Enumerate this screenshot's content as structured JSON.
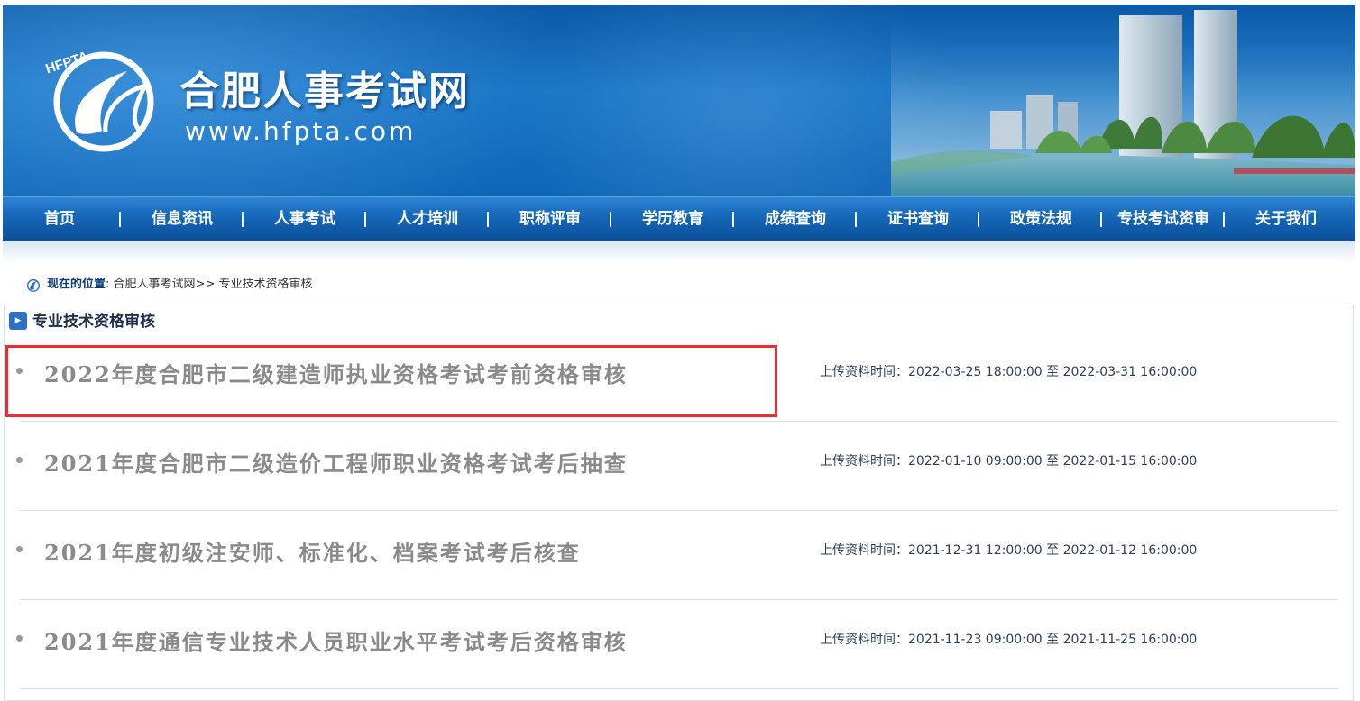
{
  "header": {
    "site_title": "合肥人事考试网",
    "site_url": "www.hfpta.com",
    "logo_text": "HFPTA"
  },
  "nav": {
    "items": [
      "首页",
      "信息资讯",
      "人事考试",
      "人才培训",
      "职称评审",
      "学历教育",
      "成绩查询",
      "证书查询",
      "政策法规",
      "专技考试资审",
      "关于我们"
    ],
    "separator": "|"
  },
  "breadcrumb": {
    "label": "现在的位置",
    "colon": ":",
    "home": "合肥人事考试网",
    "arrow": ">>",
    "current": "专业技术资格审核"
  },
  "section": {
    "title": "专业技术资格审核",
    "items": [
      {
        "title": "2022年度合肥市二级建造师执业资格考试考前资格审核",
        "time_label": "上传资料时间：",
        "start": "2022-03-25 18:00:00",
        "to": "至",
        "end": "2022-03-31 16:00:00"
      },
      {
        "title": "2021年度合肥市二级造价工程师职业资格考试考后抽查",
        "time_label": "上传资料时间：",
        "start": "2022-01-10 09:00:00",
        "to": "至",
        "end": "2022-01-15 16:00:00"
      },
      {
        "title": "2021年度初级注安师、标准化、档案考试考后核查",
        "time_label": "上传资料时间：",
        "start": "2021-12-31 12:00:00",
        "to": "至",
        "end": "2022-01-12 16:00:00"
      },
      {
        "title": "2021年度通信专业技术人员职业水平考试考后资格审核",
        "time_label": "上传资料时间：",
        "start": "2021-11-23 09:00:00",
        "to": "至",
        "end": "2021-11-25 16:00:00"
      }
    ]
  },
  "colors": {
    "banner_blue": "#1672c4",
    "nav_blue": "#1669bb",
    "highlight_red": "#ee2a2f",
    "item_title_gray": "#8a8a8a"
  }
}
